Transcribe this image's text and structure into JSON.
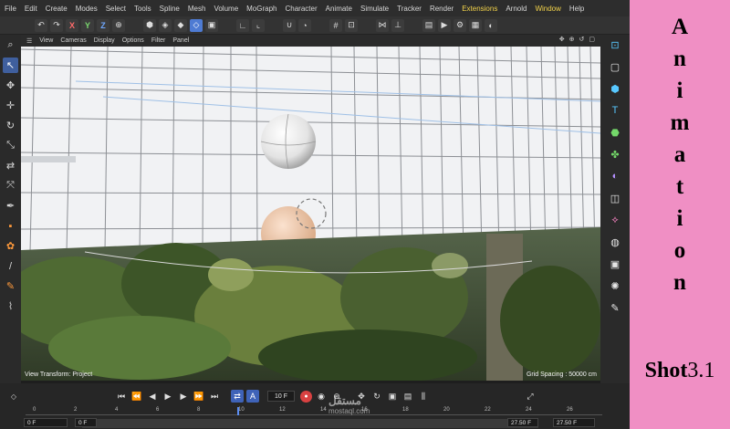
{
  "menu": [
    "File",
    "Edit",
    "Create",
    "Modes",
    "Select",
    "Tools",
    "Spline",
    "Mesh",
    "Volume",
    "MoGraph",
    "Character",
    "Animate",
    "Simulate",
    "Tracker",
    "Render",
    "Extensions",
    "Arnold",
    "Window",
    "Help"
  ],
  "toolbar": {
    "axis_x": "X",
    "axis_y": "Y",
    "axis_z": "Z"
  },
  "viewport_menu": [
    "View",
    "Cameras",
    "Display",
    "Options",
    "Filter",
    "Panel"
  ],
  "viewport": {
    "view_transform": "View Transform: Project",
    "grid_spacing": "Grid Spacing : 50000 cm"
  },
  "timeline": {
    "current_frame": "10 F",
    "ruler_ticks": [
      "0",
      "2",
      "4",
      "6",
      "8",
      "10",
      "12",
      "14",
      "16",
      "18",
      "20",
      "22",
      "24",
      "26"
    ],
    "range_start": "0 F",
    "range_start_2": "0 F",
    "range_end": "27.50 F",
    "range_end_2": "27.50 F"
  },
  "watermark": {
    "arabic": "مستقل",
    "latin": "mostaql.com"
  },
  "side_title": [
    "A",
    "n",
    "i",
    "m",
    "a",
    "t",
    "i",
    "o",
    "n"
  ],
  "shot_label": {
    "prefix": "Shot",
    "number": "3.1"
  },
  "colors": {
    "side_panel": "#f08fc4",
    "accent_menu": "#f3d34a",
    "active_tool": "#4e7bd3"
  }
}
